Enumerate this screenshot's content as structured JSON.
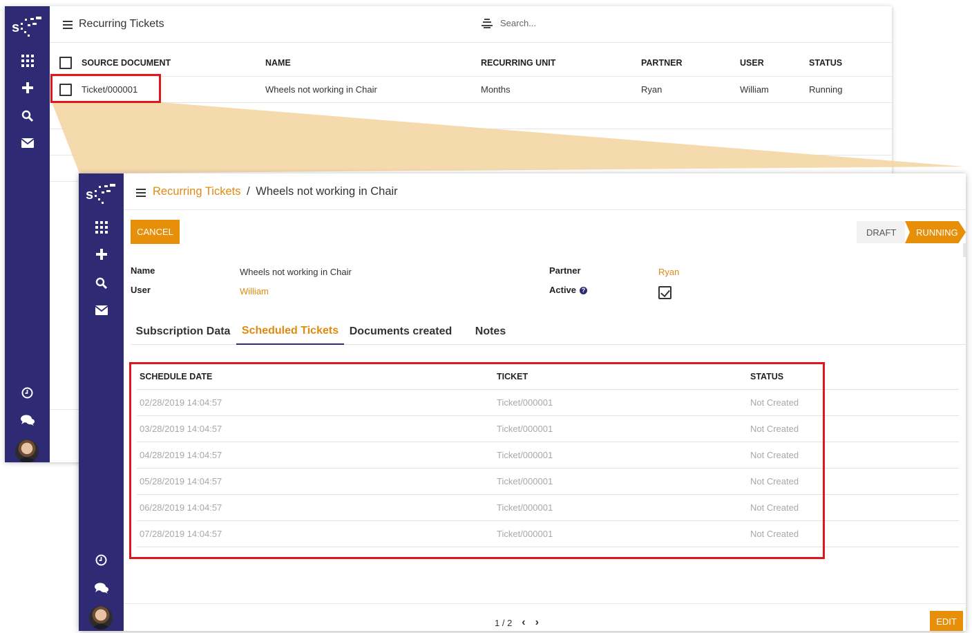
{
  "back_window": {
    "title": "Recurring Tickets",
    "search_placeholder": "Search...",
    "columns": [
      "SOURCE DOCUMENT",
      "NAME",
      "RECURRING UNIT",
      "PARTNER",
      "USER",
      "STATUS"
    ],
    "rows": [
      {
        "source_document": "Ticket/000001",
        "name": "Wheels not working in Chair",
        "recurring_unit": "Months",
        "partner": "Ryan",
        "user": "William",
        "status": "Running"
      }
    ]
  },
  "front_window": {
    "breadcrumb": {
      "parent": "Recurring Tickets",
      "separator": "/",
      "current": "Wheels not working in Chair"
    },
    "cancel_label": "CANCEL",
    "status_steps": [
      "DRAFT",
      "RUNNING"
    ],
    "active_status": "RUNNING",
    "fields": {
      "name_label": "Name",
      "name_value": "Wheels not working in Chair",
      "user_label": "User",
      "user_value": "William",
      "partner_label": "Partner",
      "partner_value": "Ryan",
      "active_label": "Active",
      "active_help": "?",
      "active_checked": true
    },
    "tabs": [
      "Subscription Data",
      "Scheduled Tickets",
      "Documents created",
      "Notes"
    ],
    "active_tab": "Scheduled Tickets",
    "schedule": {
      "columns": [
        "SCHEDULE DATE",
        "TICKET",
        "STATUS"
      ],
      "rows": [
        {
          "date": "02/28/2019 14:04:57",
          "ticket": "Ticket/000001",
          "status": "Not Created"
        },
        {
          "date": "03/28/2019 14:04:57",
          "ticket": "Ticket/000001",
          "status": "Not Created"
        },
        {
          "date": "04/28/2019 14:04:57",
          "ticket": "Ticket/000001",
          "status": "Not Created"
        },
        {
          "date": "05/28/2019 14:04:57",
          "ticket": "Ticket/000001",
          "status": "Not Created"
        },
        {
          "date": "06/28/2019 14:04:57",
          "ticket": "Ticket/000001",
          "status": "Not Created"
        },
        {
          "date": "07/28/2019 14:04:57",
          "ticket": "Ticket/000001",
          "status": "Not Created"
        }
      ]
    },
    "pager": {
      "label": "1 / 2",
      "prev": "‹",
      "next": "›"
    },
    "edit_label": "EDIT"
  },
  "colors": {
    "sidebar": "#2e2a74",
    "accent": "#e88f09",
    "link": "#e08a0f",
    "highlight": "#e0161d",
    "wedge": "#f3d49f"
  },
  "icons": [
    "apps-grid-icon",
    "plus-icon",
    "search-icon",
    "mail-icon",
    "clock-icon",
    "chat-icon",
    "hamburger-icon",
    "filter-icon",
    "chevron-left-icon",
    "chevron-right-icon"
  ]
}
